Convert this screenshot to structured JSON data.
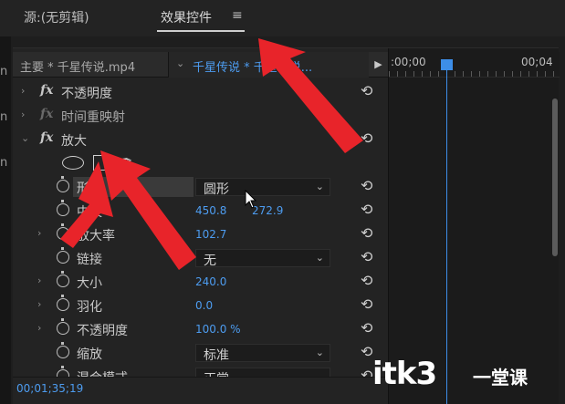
{
  "tabs": {
    "source": "源:(无剪辑)",
    "effect_controls": "效果控件",
    "menu_icon": "≡"
  },
  "left_edge_chars": [
    "n",
    "n",
    "n"
  ],
  "clip_bar": {
    "master_label": "主要 * 千星传说.mp4",
    "sequence_label": "千星传说 * 千星传说...",
    "play_icon": "▶"
  },
  "timeline": {
    "tick_start": ":00;00",
    "tick_end": "00;04"
  },
  "effects": [
    {
      "expand": "›",
      "fx": "fx",
      "name": "不透明度",
      "enabled": true,
      "reset": "⟲"
    },
    {
      "expand": "›",
      "fx": "fx",
      "name": "时间重映射",
      "enabled": false
    },
    {
      "expand": "⌄",
      "fx": "fx",
      "name": "放大",
      "enabled": true,
      "reset": "⟲"
    }
  ],
  "mask_tools": [
    "ellipse-mask-icon",
    "rectangle-mask-icon",
    "pen-mask-icon"
  ],
  "pen_glyph": "✒",
  "properties": {
    "shape": {
      "label": "形状",
      "value": "圆形",
      "chevron": "⌄",
      "reset": "⟲"
    },
    "center": {
      "label": "中央",
      "x": "450.8",
      "y": "272.9",
      "reset": "⟲"
    },
    "magnification": {
      "label": "放大率",
      "value": "102.7",
      "reset": "⟲"
    },
    "link": {
      "label": "链接",
      "value": "无",
      "chevron": "⌄",
      "reset": "⟲"
    },
    "size": {
      "label": "大小",
      "value": "240.0",
      "reset": "⟲"
    },
    "feather": {
      "label": "羽化",
      "value": "0.0",
      "reset": "⟲"
    },
    "opacity": {
      "label": "不透明度",
      "value": "100.0 %",
      "reset": "⟲"
    },
    "scaling": {
      "label": "缩放",
      "value": "标准",
      "chevron": "⌄",
      "reset": "⟲"
    },
    "blend_mode": {
      "label": "混合模式",
      "value": "正常",
      "chevron": "⌄",
      "reset": "⟲"
    }
  },
  "timecode": "00;01;35;19",
  "watermark": {
    "brand": "itk3",
    "cn": "一堂课"
  },
  "colors": {
    "accent": "#4d9cf0",
    "playhead": "#3d8ee8",
    "arrow": "#e8242a",
    "panel": "#232323"
  }
}
